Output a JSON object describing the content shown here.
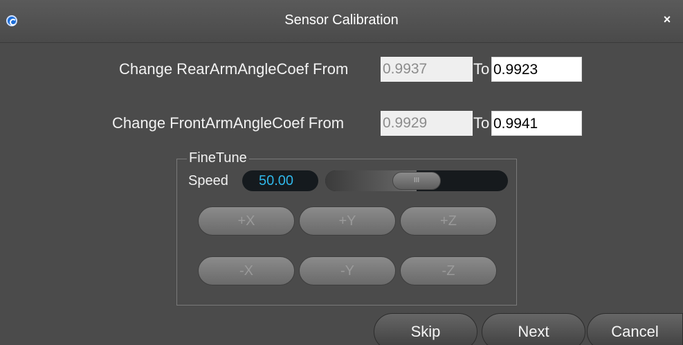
{
  "window": {
    "title": "Sensor Calibration",
    "close_label": "×"
  },
  "rear": {
    "label": "Change RearArmAngleCoef From",
    "from_value": "0.9937",
    "to_label": "To",
    "to_value": "0.9923"
  },
  "front": {
    "label": "Change FrontArmAngleCoef From",
    "from_value": "0.9929",
    "to_label": "To",
    "to_value": "0.9941"
  },
  "finetune": {
    "title": "FineTune",
    "speed_label": "Speed",
    "speed_value": "50.00",
    "slider_level": 0.5,
    "slider_handle_glyph": "III",
    "buttons": [
      "+X",
      "+Y",
      "+Z",
      "-X",
      "-Y",
      "-Z"
    ]
  },
  "actions": {
    "skip": "Skip",
    "next": "Next",
    "cancel": "Cancel"
  },
  "colors": {
    "background": "#4b4b4b",
    "speed_value": "#2fb6e8",
    "app_icon": "#1e6fd9"
  }
}
